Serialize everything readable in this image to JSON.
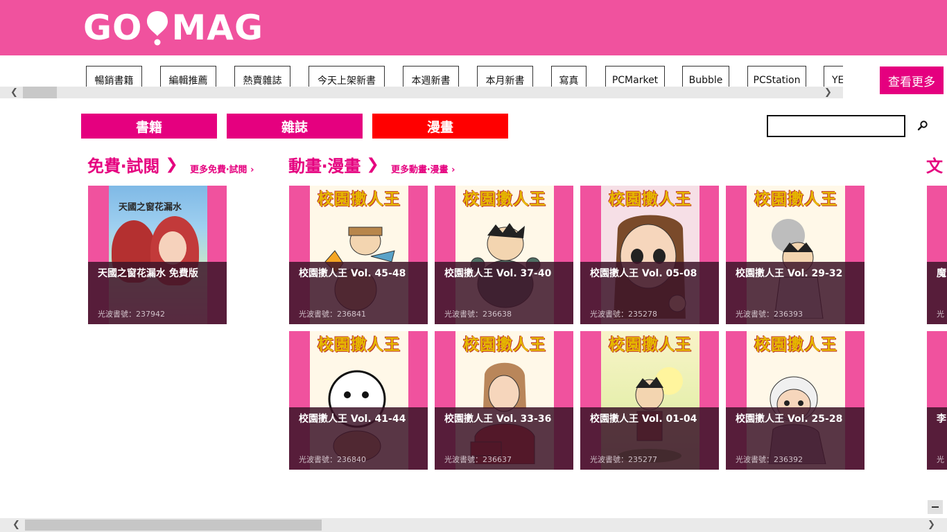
{
  "header": {
    "logo": {
      "left": "GO",
      "right": "MAG"
    },
    "more_button": "查看更多"
  },
  "tags": [
    "暢銷書籍",
    "編輯推薦",
    "熱賣雜誌",
    "今天上架新書",
    "本週新書",
    "本月新書",
    "寫真",
    "PCMarket",
    "Bubble",
    "PCStation",
    "YE"
  ],
  "category_tabs": [
    {
      "label": "書籍",
      "active": false
    },
    {
      "label": "雜誌",
      "active": false
    },
    {
      "label": "漫畫",
      "active": true
    }
  ],
  "search": {
    "value": "",
    "placeholder": ""
  },
  "sections": {
    "free": {
      "title": "免費‧試閱",
      "more": "更多免費‧試閱",
      "books": [
        {
          "name": "天國之窗花漏水 免費版",
          "code": "光波書號：237942",
          "cover_text": "天國之窗花漏水"
        }
      ]
    },
    "anime": {
      "title": "動畫‧漫畫",
      "more": "更多動畫‧漫畫",
      "cover_title": "校園擻人王",
      "books": [
        {
          "name": "校園擻人王 Vol. 45-48",
          "code": "光波書號：236841"
        },
        {
          "name": "校園擻人王 Vol. 37-40",
          "code": "光波書號：236638"
        },
        {
          "name": "校園擻人王 Vol. 05-08",
          "code": "光波書號：235278"
        },
        {
          "name": "校園擻人王 Vol. 29-32",
          "code": "光波書號：236393"
        },
        {
          "name": "校園擻人王 Vol. 41-44",
          "code": "光波書號：236840"
        },
        {
          "name": "校園擻人王 Vol. 33-36",
          "code": "光波書號：236637"
        },
        {
          "name": "校園擻人王 Vol. 01-04",
          "code": "光波書號：235277"
        },
        {
          "name": "校園擻人王 Vol. 25-28",
          "code": "光波書號：236392"
        }
      ]
    },
    "third": {
      "title_partial": "文",
      "books": [
        {
          "name_partial": "魔",
          "code_partial": "光"
        },
        {
          "name_partial": "李",
          "code_partial": "光"
        }
      ]
    }
  },
  "colors": {
    "header_bg": "#f0529e",
    "accent": "#e5007f",
    "active_tab": "#ff0000",
    "card_bg": "#f0529e"
  }
}
